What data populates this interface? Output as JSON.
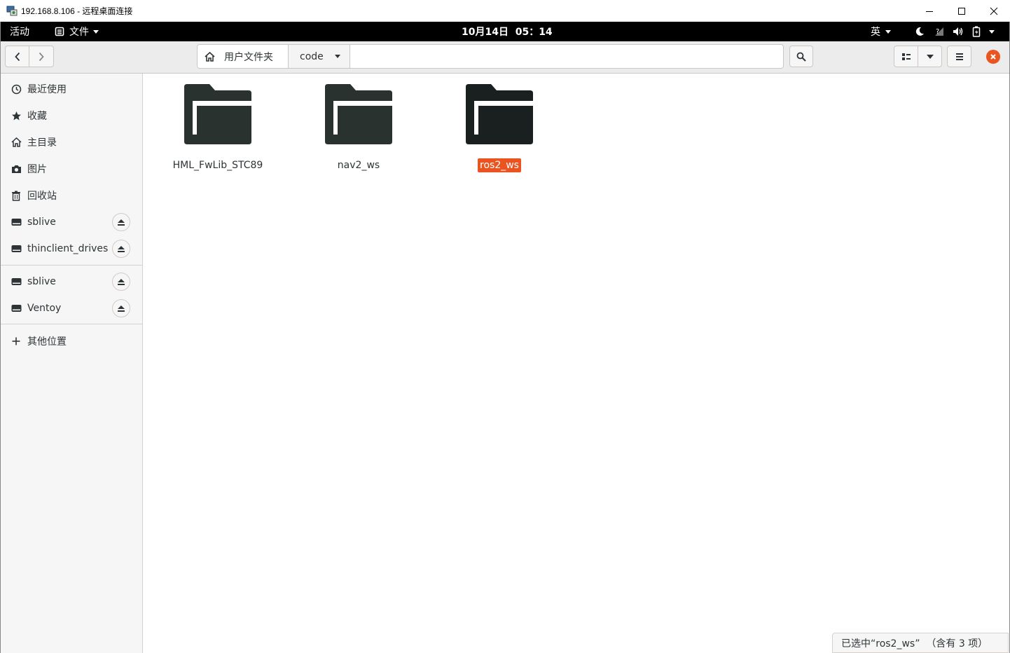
{
  "window": {
    "title": "192.168.8.106 - 远程桌面连接",
    "minimize_glyph": "—",
    "maximize_glyph": "☐",
    "close_glyph": "✕"
  },
  "topbar": {
    "activities": "活动",
    "app_menu": "文件",
    "clock": "10月14日  05：14",
    "input_method": "英"
  },
  "headerbar": {
    "path": [
      {
        "label": "用户文件夹",
        "icon": "home-icon"
      },
      {
        "label": "code"
      }
    ]
  },
  "sidebar": {
    "places": [
      {
        "label": "最近使用",
        "icon": "clock-icon"
      },
      {
        "label": "收藏",
        "icon": "star-icon"
      },
      {
        "label": "主目录",
        "icon": "home-icon"
      },
      {
        "label": "图片",
        "icon": "camera-icon"
      },
      {
        "label": "回收站",
        "icon": "trash-icon"
      }
    ],
    "devices": [
      {
        "label": "sblive",
        "icon": "drive-icon"
      },
      {
        "label": "thinclient_drives",
        "icon": "drive-icon"
      }
    ],
    "network": [
      {
        "label": "sblive",
        "icon": "drive-icon"
      },
      {
        "label": "Ventoy",
        "icon": "drive-icon"
      }
    ],
    "other": {
      "label": "其他位置",
      "icon": "plus-icon"
    }
  },
  "files": [
    {
      "name": "HML_FwLib_STC89",
      "selected": false
    },
    {
      "name": "nav2_ws",
      "selected": false
    },
    {
      "name": "ros2_ws",
      "selected": true
    }
  ],
  "status": "已选中“ros2_ws”  （含有 3 项）",
  "colors": {
    "accent": "#e95420",
    "folder": "#2a3230",
    "folder_selected": "#1a1f1f"
  }
}
